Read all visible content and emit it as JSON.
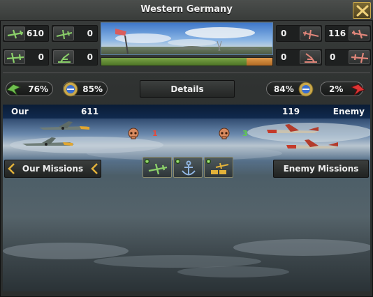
{
  "header": {
    "title": "Western Germany"
  },
  "colors": {
    "our": "#5fa24a",
    "enemy": "#d9382f",
    "accent": "#c9a84c"
  },
  "our_forces": {
    "fighters": {
      "icon": "fighter-plane-icon",
      "value": "610"
    },
    "cas": {
      "icon": "cas-plane-icon",
      "value": "0"
    },
    "naval_bombers": {
      "icon": "naval-bomber-icon",
      "value": "0"
    },
    "aa_guns": {
      "icon": "anti-air-gun-icon",
      "value": "0"
    }
  },
  "enemy_forces": {
    "cas": {
      "icon": "cas-plane-icon",
      "value": "0"
    },
    "fighters": {
      "icon": "fighter-plane-icon",
      "value": "116"
    },
    "aa_guns": {
      "icon": "anti-air-gun-icon",
      "value": "0"
    },
    "naval_bombers": {
      "icon": "naval-bomber-icon",
      "value": "0"
    }
  },
  "air_superiority": {
    "our_fraction": 0.85,
    "enemy_fraction": 0.15
  },
  "our_stats": {
    "superiority": "76%",
    "efficiency": "85%"
  },
  "enemy_stats": {
    "efficiency": "84%",
    "superiority": "2%"
  },
  "details_label": "Details",
  "battle": {
    "our_label": "Our",
    "our_count": "611",
    "enemy_count": "119",
    "enemy_label": "Enemy",
    "our_losses": "1",
    "enemy_losses": "3"
  },
  "missions": {
    "our_label": "Our Missions",
    "enemy_label": "Enemy Missions",
    "tiles": [
      {
        "icon": "air-superiority-mission-icon"
      },
      {
        "icon": "naval-anchor-mission-icon"
      },
      {
        "icon": "logistics-strike-mission-icon"
      }
    ]
  }
}
